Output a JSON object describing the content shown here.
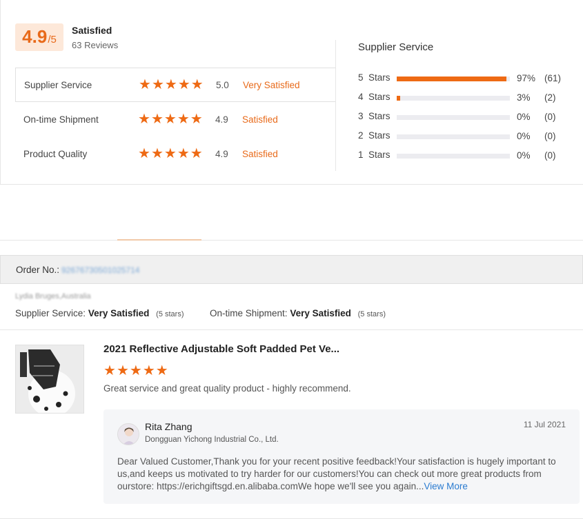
{
  "overall": {
    "score": "4.9",
    "out_of": "/5",
    "label": "Satisfied",
    "reviews": "63 Reviews"
  },
  "ratings": [
    {
      "name": "Supplier Service",
      "stars": 5,
      "value": "5.0",
      "word": "Very Satisfied"
    },
    {
      "name": "On-time Shipment",
      "stars": 5,
      "value": "4.9",
      "word": "Satisfied"
    },
    {
      "name": "Product Quality",
      "stars": 5,
      "value": "4.9",
      "word": "Satisfied"
    }
  ],
  "distribution": {
    "title": "Supplier Service",
    "rows": [
      {
        "label": "5  Stars",
        "fraction": 0.97,
        "pct": "97%",
        "count": "(61)"
      },
      {
        "label": "4  Stars",
        "fraction": 0.03,
        "pct": "3%",
        "count": "(2)"
      },
      {
        "label": "3  Stars",
        "fraction": 0.0,
        "pct": "0%",
        "count": "(0)"
      },
      {
        "label": "2  Stars",
        "fraction": 0.0,
        "pct": "0%",
        "count": "(0)"
      },
      {
        "label": "1  Stars",
        "fraction": 0.0,
        "pct": "0%",
        "count": "(0)"
      }
    ]
  },
  "order": {
    "label": "Order No.:",
    "number": "92676730501025714"
  },
  "review": {
    "buyer": "Lydia Bruges,Australia",
    "supplier_service_label": "Supplier Service:",
    "supplier_service_value": "Very Satisfied",
    "supplier_service_stars": "(5 stars)",
    "shipment_label": "On-time Shipment:",
    "shipment_value": "Very Satisfied",
    "shipment_stars": "(5 stars)",
    "product_title": "2021 Reflective Adjustable Soft Padded Pet Ve...",
    "rating": 5,
    "text": "Great service and great quality product - highly recommend."
  },
  "reply": {
    "name": "Rita Zhang",
    "company": "Dongguan Yichong Industrial Co., Ltd.",
    "date": "11 Jul 2021",
    "text": "Dear Valued Customer,Thank you for your recent positive feedback!Your satisfaction is hugely important to us,and keeps us motivated to try harder for our customers!You can check out more great products from ourstore: https://erichgiftsgd.en.alibaba.comWe hope we'll see you again...",
    "view_more": "View More"
  },
  "colors": {
    "accent": "#ee6a14",
    "link": "#2a7bd0"
  }
}
